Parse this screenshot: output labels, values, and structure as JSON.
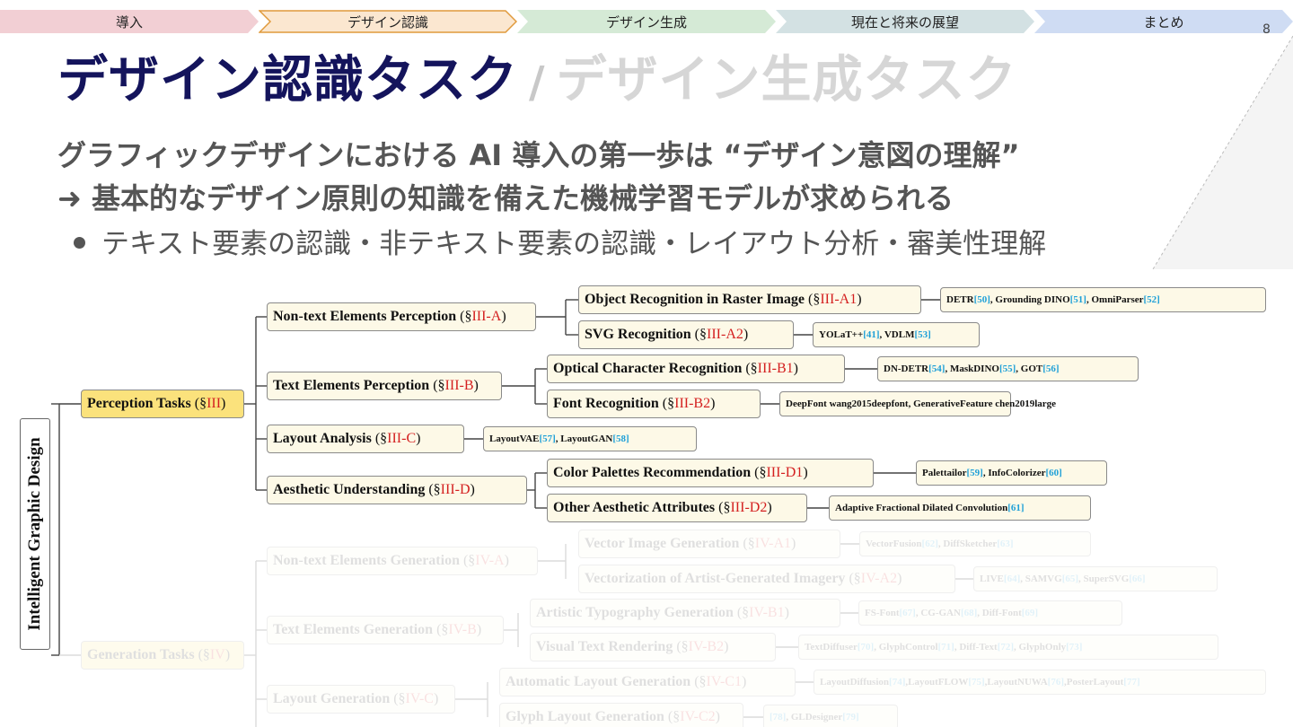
{
  "tabs": [
    {
      "label": "導入",
      "color": "#f2cfd4"
    },
    {
      "label": "デザイン認識",
      "color": "#fbe7d0",
      "active": true
    },
    {
      "label": "デザイン生成",
      "color": "#d5ead6"
    },
    {
      "label": "現在と将来の展望",
      "color": "#d3e1e3"
    },
    {
      "label": "まとめ",
      "color": "#cfdcf3"
    }
  ],
  "page_number": "8",
  "title": {
    "active": "デザイン認識タスク",
    "separator": "/",
    "inactive": "デザイン生成タスク"
  },
  "subtitle_line1": "グラフィックデザインにおける AI 導入の第一歩は “デザイン意図の理解”",
  "subtitle_line2": "➜ 基本的なデザイン原則の知識を備えた機械学習モデルが求められる",
  "bullet": "テキスト要素の認識・非テキスト要素の認識・レイアウト分析・審美性理解",
  "tree": {
    "root": "Intelligent Graphic Design",
    "perception": {
      "label": "Perception Tasks",
      "sec": "III"
    },
    "generation": {
      "label": "Generation Tasks",
      "sec": "IV"
    },
    "p_children": [
      {
        "label": "Non-text Elements Perception",
        "sec": "III-A"
      },
      {
        "label": "Text Elements Perception",
        "sec": "III-B"
      },
      {
        "label": "Layout Analysis",
        "sec": "III-C"
      },
      {
        "label": "Aesthetic Understanding",
        "sec": "III-D"
      }
    ],
    "p_leaves": [
      {
        "label": "Object Recognition in Raster Image",
        "sec": "III-A1"
      },
      {
        "label": "SVG Recognition",
        "sec": "III-A2"
      },
      {
        "label": "Optical Character Recognition",
        "sec": "III-B1"
      },
      {
        "label": "Font Recognition",
        "sec": "III-B2"
      },
      {
        "label": "Color Palettes Recommendation",
        "sec": "III-D1"
      },
      {
        "label": "Other Aesthetic Attributes",
        "sec": "III-D2"
      }
    ],
    "p_refs": [
      {
        "parts": [
          [
            "DETR ",
            ""
          ],
          [
            "[50]",
            "c"
          ],
          [
            ", Grounding DINO ",
            ""
          ],
          [
            "[51]",
            "c"
          ],
          [
            ", OmniParser ",
            ""
          ],
          [
            "[52]",
            "c"
          ]
        ]
      },
      {
        "parts": [
          [
            "YOLaT++ ",
            ""
          ],
          [
            "[41]",
            "c"
          ],
          [
            ", VDLM ",
            ""
          ],
          [
            "[53]",
            "c"
          ]
        ]
      },
      {
        "parts": [
          [
            "DN-DETR ",
            ""
          ],
          [
            "[54]",
            "c"
          ],
          [
            ", MaskDINO ",
            ""
          ],
          [
            "[55]",
            "c"
          ],
          [
            ", GOT ",
            ""
          ],
          [
            "[56]",
            "c"
          ]
        ]
      },
      {
        "parts": [
          [
            "DeepFont wang2015deepfont, GenerativeFeature chen2019large",
            ""
          ]
        ]
      },
      {
        "parts": [
          [
            "LayoutVAE ",
            ""
          ],
          [
            "[57]",
            "c"
          ],
          [
            ", LayoutGAN ",
            ""
          ],
          [
            "[58]",
            "c"
          ]
        ]
      },
      {
        "parts": [
          [
            "Palettailor ",
            ""
          ],
          [
            "[59]",
            "c"
          ],
          [
            ", InfoColorizer ",
            ""
          ],
          [
            "[60]",
            "c"
          ]
        ]
      },
      {
        "parts": [
          [
            "Adaptive Fractional Dilated Convolution ",
            ""
          ],
          [
            "[61]",
            "c"
          ]
        ]
      }
    ],
    "g_children": [
      {
        "label": "Non-text Elements Generation",
        "sec": "IV-A"
      },
      {
        "label": "Text Elements Generation",
        "sec": "IV-B"
      },
      {
        "label": "Layout Generation",
        "sec": "IV-C"
      }
    ],
    "g_leaves": [
      {
        "label": "Vector Image Generation",
        "sec": "IV-A1"
      },
      {
        "label": "Vectorization of Artist-Generated Imagery",
        "sec": "IV-A2"
      },
      {
        "label": "Artistic Typography Generation",
        "sec": "IV-B1"
      },
      {
        "label": "Visual Text Rendering",
        "sec": "IV-B2"
      },
      {
        "label": "Automatic Layout Generation",
        "sec": "IV-C1"
      },
      {
        "label": "Glyph Layout Generation",
        "sec": "IV-C2"
      }
    ],
    "g_refs": [
      {
        "parts": [
          [
            "VectorFusion ",
            ""
          ],
          [
            "[62]",
            "c"
          ],
          [
            ", DiffSketcher ",
            ""
          ],
          [
            "[63]",
            "c"
          ]
        ]
      },
      {
        "parts": [
          [
            "LIVE ",
            ""
          ],
          [
            "[64]",
            "c"
          ],
          [
            ", SAMVG ",
            ""
          ],
          [
            "[65]",
            "c"
          ],
          [
            ", SuperSVG ",
            ""
          ],
          [
            "[66]",
            "c"
          ]
        ]
      },
      {
        "parts": [
          [
            "FS-Font ",
            ""
          ],
          [
            "[67]",
            "c"
          ],
          [
            ", CG-GAN ",
            ""
          ],
          [
            "[68]",
            "c"
          ],
          [
            ", Diff-Font ",
            ""
          ],
          [
            "[69]",
            "c"
          ]
        ]
      },
      {
        "parts": [
          [
            "TextDiffuser ",
            ""
          ],
          [
            "[70]",
            "c"
          ],
          [
            ", GlyphControl ",
            ""
          ],
          [
            "[71]",
            "c"
          ],
          [
            ", Diff-Text ",
            ""
          ],
          [
            "[72]",
            "c"
          ],
          [
            ", GlyphOnly ",
            ""
          ],
          [
            "[73]",
            "c"
          ]
        ]
      },
      {
        "parts": [
          [
            "LayoutDiffusion ",
            ""
          ],
          [
            "[74]",
            "c"
          ],
          [
            ",LayoutFLOW ",
            ""
          ],
          [
            "[75]",
            "c"
          ],
          [
            ",LayoutNUWA ",
            ""
          ],
          [
            "[76]",
            "c"
          ],
          [
            ",PosterLayout ",
            ""
          ],
          [
            "[77]",
            "c"
          ]
        ]
      },
      {
        "parts": [
          [
            "[78]",
            "c"
          ],
          [
            ", GLDesigner ",
            ""
          ],
          [
            "[79]",
            "c"
          ]
        ]
      }
    ]
  }
}
